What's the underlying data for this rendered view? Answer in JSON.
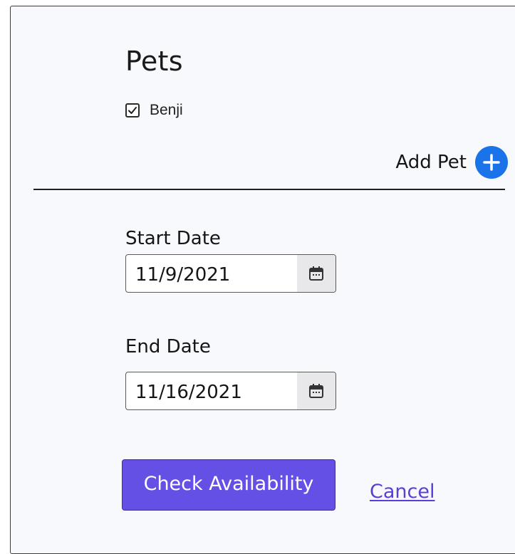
{
  "pets": {
    "title": "Pets",
    "items": [
      {
        "name": "Benji",
        "checked": true
      }
    ],
    "add_label": "Add Pet"
  },
  "dates": {
    "start_label": "Start Date",
    "start_value": "11/9/2021",
    "end_label": "End Date",
    "end_value": "11/16/2021"
  },
  "actions": {
    "check_label": "Check Availability",
    "cancel_label": "Cancel"
  },
  "colors": {
    "primary_button": "#6550e6",
    "add_icon": "#1a73e8",
    "link": "#5a3fd6"
  },
  "icons": {
    "checkbox": "check-icon",
    "add": "plus-icon",
    "date_picker": "calendar-icon"
  }
}
